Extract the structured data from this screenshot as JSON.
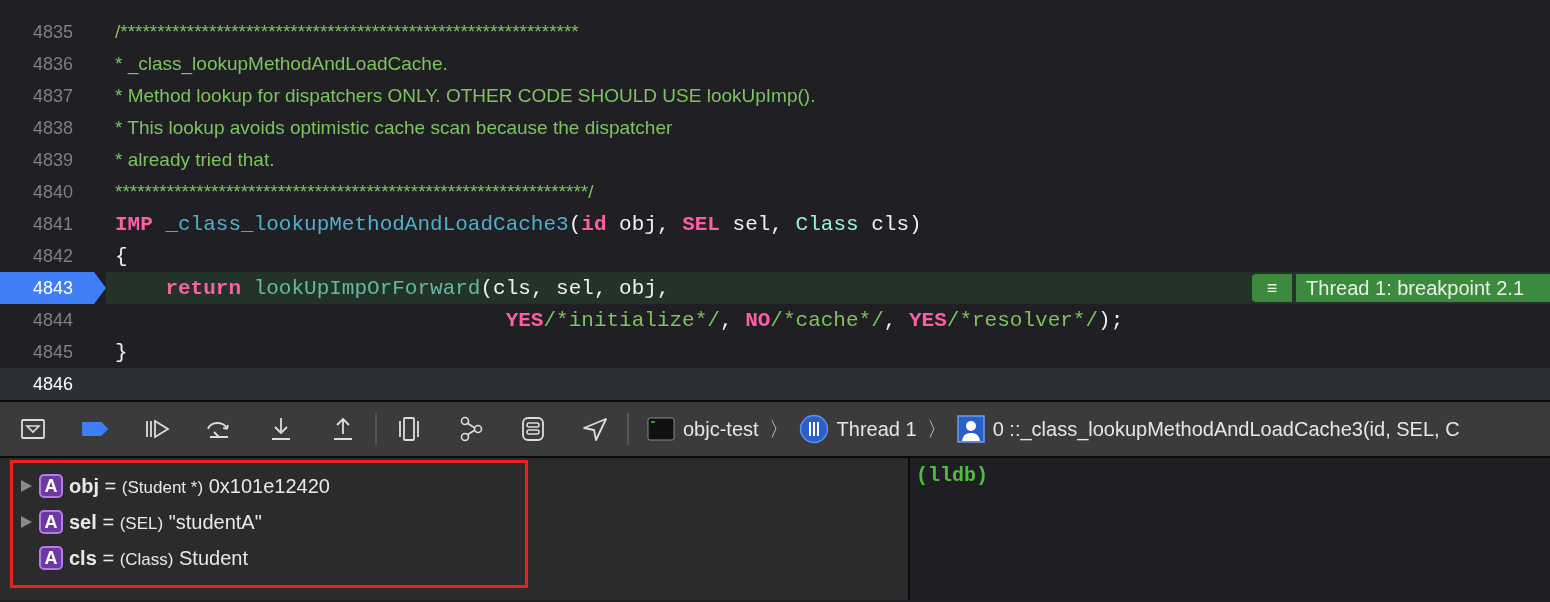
{
  "editor": {
    "lines": [
      {
        "number": "4835",
        "breakpoint": false,
        "stopped": false,
        "cursor": false,
        "tokens": [
          {
            "kind": "doc",
            "text": "/**************************************************************"
          }
        ]
      },
      {
        "number": "4836",
        "breakpoint": false,
        "stopped": false,
        "cursor": false,
        "tokens": [
          {
            "kind": "doc",
            "text": "* _class_lookupMethodAndLoadCache."
          }
        ]
      },
      {
        "number": "4837",
        "breakpoint": false,
        "stopped": false,
        "cursor": false,
        "tokens": [
          {
            "kind": "doc",
            "text": "* Method lookup for dispatchers ONLY. OTHER CODE SHOULD USE lookUpImp()."
          }
        ]
      },
      {
        "number": "4838",
        "breakpoint": false,
        "stopped": false,
        "cursor": false,
        "tokens": [
          {
            "kind": "doc",
            "text": "* This lookup avoids optimistic cache scan because the dispatcher"
          }
        ]
      },
      {
        "number": "4839",
        "breakpoint": false,
        "stopped": false,
        "cursor": false,
        "tokens": [
          {
            "kind": "doc",
            "text": "* already tried that."
          }
        ]
      },
      {
        "number": "4840",
        "breakpoint": false,
        "stopped": false,
        "cursor": false,
        "tokens": [
          {
            "kind": "doc",
            "text": "****************************************************************/"
          }
        ]
      },
      {
        "number": "4841",
        "breakpoint": false,
        "stopped": false,
        "cursor": false,
        "tokens": [
          {
            "kind": "keyword",
            "text": "IMP"
          },
          {
            "kind": "func",
            "text": " _class_lookupMethodAndLoadCache3"
          },
          {
            "kind": "plain",
            "text": "("
          },
          {
            "kind": "keyword",
            "text": "id"
          },
          {
            "kind": "plain",
            "text": " obj, "
          },
          {
            "kind": "keyword",
            "text": "SEL"
          },
          {
            "kind": "plain",
            "text": " sel, "
          },
          {
            "kind": "type",
            "text": "Class"
          },
          {
            "kind": "plain",
            "text": " cls)"
          }
        ]
      },
      {
        "number": "4842",
        "breakpoint": false,
        "stopped": false,
        "cursor": false,
        "tokens": [
          {
            "kind": "plain",
            "text": "{"
          }
        ]
      },
      {
        "number": "4843",
        "breakpoint": true,
        "stopped": true,
        "cursor": false,
        "annotation": {
          "icon": "≡",
          "text": "Thread 1: breakpoint 2.1"
        },
        "tokens": [
          {
            "kind": "keyword",
            "text": "    return"
          },
          {
            "kind": "call",
            "text": " lookUpImpOrForward"
          },
          {
            "kind": "plain",
            "text": "(cls, sel, obj,"
          }
        ]
      },
      {
        "number": "4844",
        "breakpoint": false,
        "stopped": false,
        "cursor": false,
        "tokens": [
          {
            "kind": "keyword",
            "text": "                               YES"
          },
          {
            "kind": "comment",
            "text": "/*initialize*/"
          },
          {
            "kind": "plain",
            "text": ", "
          },
          {
            "kind": "keyword",
            "text": "NO"
          },
          {
            "kind": "comment",
            "text": "/*cache*/"
          },
          {
            "kind": "plain",
            "text": ", "
          },
          {
            "kind": "keyword",
            "text": "YES"
          },
          {
            "kind": "comment",
            "text": "/*resolver*/"
          },
          {
            "kind": "plain",
            "text": ");"
          }
        ]
      },
      {
        "number": "4845",
        "breakpoint": false,
        "stopped": false,
        "cursor": false,
        "tokens": [
          {
            "kind": "plain",
            "text": "}"
          }
        ]
      },
      {
        "number": "4846",
        "breakpoint": false,
        "stopped": false,
        "cursor": true
      }
    ]
  },
  "debug_bar": {
    "buttons": [
      {
        "kind": "hide"
      },
      {
        "kind": "breakpoints",
        "on": true
      },
      {
        "kind": "continue"
      },
      {
        "kind": "step-over"
      },
      {
        "kind": "step-into"
      },
      {
        "kind": "step-out"
      },
      {
        "kind": "separator"
      },
      {
        "kind": "view-debugger"
      },
      {
        "kind": "memory-graph"
      },
      {
        "kind": "environment"
      },
      {
        "kind": "location"
      },
      {
        "kind": "separator"
      }
    ],
    "breadcrumb": [
      {
        "kind": "app",
        "text": "objc-test"
      },
      {
        "kind": "thread",
        "text": "Thread 1"
      },
      {
        "kind": "frame",
        "text": "0 ::_class_lookupMethodAndLoadCache3(id, SEL, C"
      }
    ],
    "chevron": "〉"
  },
  "variables": [
    {
      "expandable": true,
      "badge": "A",
      "name": "obj",
      "equals": "=",
      "type": "(Student *)",
      "value": "0x101e12420"
    },
    {
      "expandable": true,
      "badge": "A",
      "name": "sel",
      "equals": "=",
      "type": "(SEL)",
      "value": "\"studentA\""
    },
    {
      "expandable": false,
      "badge": "A",
      "name": "cls",
      "equals": "=",
      "type": "(Class)",
      "value": "Student"
    }
  ],
  "console": {
    "prompt": "(lldb)"
  }
}
